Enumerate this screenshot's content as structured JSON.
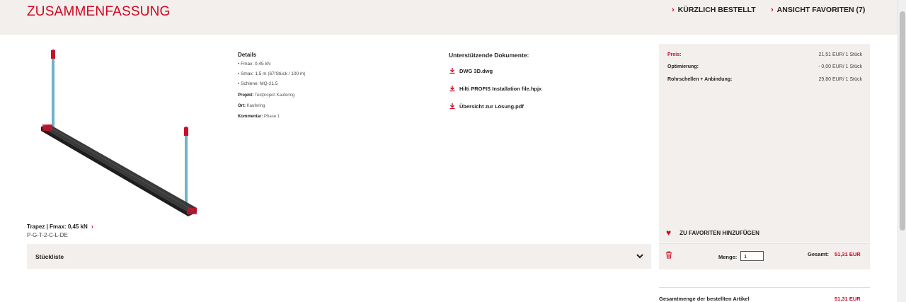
{
  "header": {
    "title": "ZUSAMMENFASSUNG",
    "recent_link": "KÜRZLICH BESTELLT",
    "favorites_link": "ANSICHT FAVORITEN (7)"
  },
  "product": {
    "name": "Trapez | Fmax: 0,45 kN",
    "code": "P-G-T-2-C-L-DE",
    "image_icon": "trapeze-support-render"
  },
  "details": {
    "heading": "Details",
    "items": [
      "Fmax: 0,45 kN",
      "Smax: 1,5 m (67/Stück / 100 m)",
      "Schiene: MQ-21.5"
    ],
    "project_label": "Projekt:",
    "project_value": "Testproject Kaufering",
    "location_label": "Ort:",
    "location_value": "Kaufering",
    "comment_label": "Kommentar:",
    "comment_value": "Phase 1"
  },
  "documents": {
    "heading": "Unterstützende Dokumente:",
    "files": [
      "DWG 3D.dwg",
      "Hilti PROFIS Installation file.hpjx",
      "Übersicht zur Lösung.pdf"
    ]
  },
  "parts_list": {
    "label": "Stückliste"
  },
  "pricing": {
    "rows": [
      {
        "label": "Preis:",
        "value": "21,51 EUR/ 1 Stück"
      },
      {
        "label": "Optimierung:",
        "value": "- 0,00 EUR/ 1 Stück"
      },
      {
        "label": "Rohrschellen + Anbindung:",
        "value": "29,80 EUR/ 1 Stück"
      }
    ],
    "favorite_label": "ZU FAVORITEN HINZUFÜGEN"
  },
  "quantity": {
    "label": "Menge:",
    "value": "1",
    "total_label": "Gesamt:",
    "total_value": "51,31 EUR"
  },
  "summary": {
    "label": "Gesamtmenge der bestellten Artikel",
    "value": "51,31 EUR"
  },
  "colors": {
    "accent": "#d2051e",
    "panel": "#f2efec",
    "rod": "#6fb3c6"
  }
}
